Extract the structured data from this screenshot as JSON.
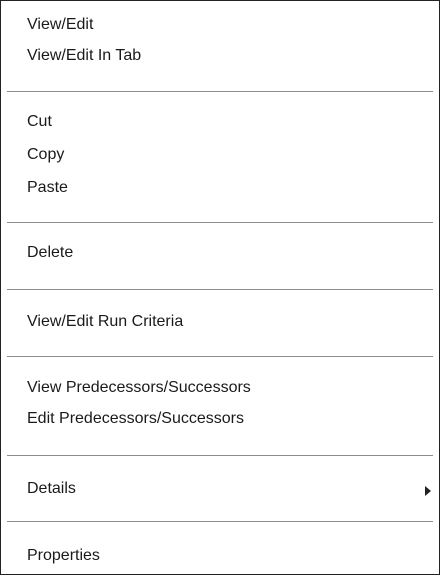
{
  "context_menu": {
    "items": [
      {
        "label": "View/Edit"
      },
      {
        "label": "View/Edit In Tab"
      },
      {
        "label": "Cut"
      },
      {
        "label": "Copy"
      },
      {
        "label": "Paste"
      },
      {
        "label": "Delete"
      },
      {
        "label": "View/Edit Run Criteria"
      },
      {
        "label": "View Predecessors/Successors"
      },
      {
        "label": "Edit Predecessors/Successors"
      },
      {
        "label": "Details",
        "icon": "chevron-right-icon"
      },
      {
        "label": "Properties"
      }
    ]
  }
}
